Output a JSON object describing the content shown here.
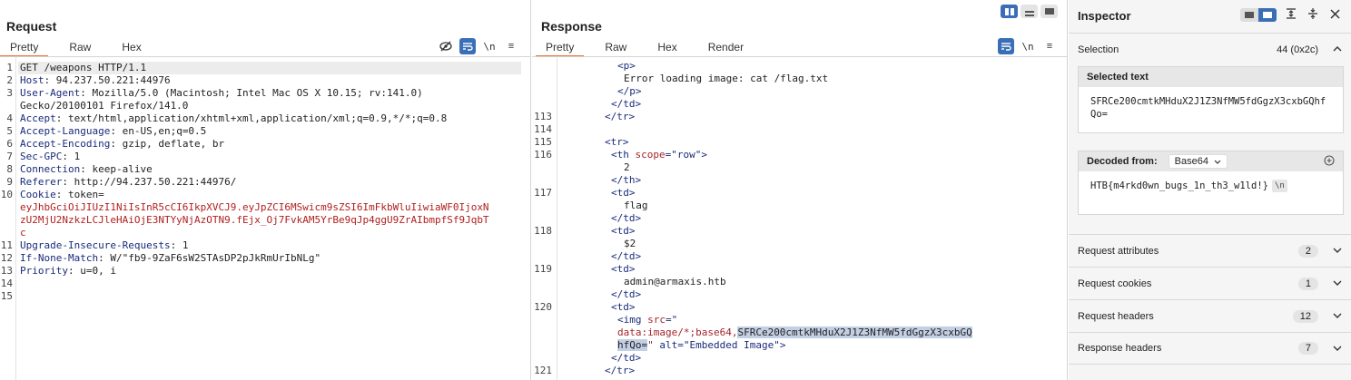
{
  "request": {
    "title": "Request",
    "tabs": [
      "Pretty",
      "Raw",
      "Hex"
    ],
    "active_tab": "Pretty",
    "tools": {
      "newline": "\\n",
      "menu": "≡"
    },
    "lines": [
      {
        "n": "1",
        "key": "",
        "val": "GET /weapons HTTP/1.1"
      },
      {
        "n": "2",
        "key": "Host",
        "val": ": 94.237.50.221:44976"
      },
      {
        "n": "3",
        "key": "User-Agent",
        "val": ": Mozilla/5.0 (Macintosh; Intel Mac OS X 10.15; rv:141.0)"
      },
      {
        "n": "",
        "key": "",
        "val": "Gecko/20100101 Firefox/141.0"
      },
      {
        "n": "4",
        "key": "Accept",
        "val": ": text/html,application/xhtml+xml,application/xml;q=0.9,*/*;q=0.8"
      },
      {
        "n": "5",
        "key": "Accept-Language",
        "val": ": en-US,en;q=0.5"
      },
      {
        "n": "6",
        "key": "Accept-Encoding",
        "val": ": gzip, deflate, br"
      },
      {
        "n": "7",
        "key": "Sec-GPC",
        "val": ": 1"
      },
      {
        "n": "8",
        "key": "Connection",
        "val": ": keep-alive"
      },
      {
        "n": "9",
        "key": "Referer",
        "val": ": http://94.237.50.221:44976/"
      },
      {
        "n": "10",
        "key": "Cookie",
        "val": ": token="
      },
      {
        "n": "",
        "key": "",
        "red": "eyJhbGciOiJIUzI1NiIsInR5cCI6IkpXVCJ9.eyJpZCI6MSwicm9sZSI6ImFkbWluIiwiaWF0IjoxN"
      },
      {
        "n": "",
        "key": "",
        "red": "zU2MjU2NzkzLCJleHAiOjE3NTYyNjAzOTN9.fEjx_Oj7FvkAM5YrBe9qJp4ggU9ZrAIbmpfSf9JqbT"
      },
      {
        "n": "",
        "key": "",
        "red": "c"
      },
      {
        "n": "11",
        "key": "Upgrade-Insecure-Requests",
        "val": ": 1"
      },
      {
        "n": "12",
        "key": "If-None-Match",
        "val": ": W/\"fb9-9ZaF6sW2STAsDP2pJkRmUrIbNLg\""
      },
      {
        "n": "13",
        "key": "Priority",
        "val": ": u=0, i"
      },
      {
        "n": "14",
        "key": "",
        "val": ""
      },
      {
        "n": "15",
        "key": "",
        "val": ""
      }
    ]
  },
  "response": {
    "title": "Response",
    "tabs": [
      "Pretty",
      "Raw",
      "Hex",
      "Render"
    ],
    "active_tab": "Pretty",
    "tools": {
      "newline": "\\n",
      "menu": "≡"
    },
    "lines": [
      {
        "n": "",
        "ind": 9,
        "parts": [
          [
            "tag",
            "<p>"
          ]
        ]
      },
      {
        "n": "",
        "ind": 10,
        "parts": [
          [
            "txt",
            "Error loading image: cat /flag.txt"
          ]
        ]
      },
      {
        "n": "",
        "ind": 9,
        "parts": [
          [
            "tag",
            "</p>"
          ]
        ]
      },
      {
        "n": "",
        "ind": 8,
        "parts": [
          [
            "tag",
            "</td>"
          ]
        ]
      },
      {
        "n": "113",
        "ind": 7,
        "parts": [
          [
            "tag",
            "</tr>"
          ]
        ]
      },
      {
        "n": "114",
        "ind": 0,
        "parts": []
      },
      {
        "n": "115",
        "ind": 7,
        "parts": [
          [
            "tag",
            "<tr>"
          ]
        ]
      },
      {
        "n": "116",
        "ind": 8,
        "parts": [
          [
            "tag",
            "<th "
          ],
          [
            "attr",
            "scope"
          ],
          [
            "tag",
            "="
          ],
          [
            "str",
            "\"row\""
          ],
          [
            "tag",
            ">"
          ]
        ]
      },
      {
        "n": "",
        "ind": 10,
        "parts": [
          [
            "txt",
            "2"
          ]
        ]
      },
      {
        "n": "",
        "ind": 8,
        "parts": [
          [
            "tag",
            "</th>"
          ]
        ]
      },
      {
        "n": "117",
        "ind": 8,
        "parts": [
          [
            "tag",
            "<td>"
          ]
        ]
      },
      {
        "n": "",
        "ind": 10,
        "parts": [
          [
            "txt",
            "flag"
          ]
        ]
      },
      {
        "n": "",
        "ind": 8,
        "parts": [
          [
            "tag",
            "</td>"
          ]
        ]
      },
      {
        "n": "118",
        "ind": 8,
        "parts": [
          [
            "tag",
            "<td>"
          ]
        ]
      },
      {
        "n": "",
        "ind": 10,
        "parts": [
          [
            "txt",
            "$2"
          ]
        ]
      },
      {
        "n": "",
        "ind": 8,
        "parts": [
          [
            "tag",
            "</td>"
          ]
        ]
      },
      {
        "n": "119",
        "ind": 8,
        "parts": [
          [
            "tag",
            "<td>"
          ]
        ]
      },
      {
        "n": "",
        "ind": 10,
        "parts": [
          [
            "txt",
            "admin@armaxis.htb"
          ]
        ]
      },
      {
        "n": "",
        "ind": 8,
        "parts": [
          [
            "tag",
            "</td>"
          ]
        ]
      },
      {
        "n": "120",
        "ind": 8,
        "parts": [
          [
            "tag",
            "<td>"
          ]
        ]
      },
      {
        "n": "",
        "ind": 9,
        "parts": [
          [
            "tag",
            "<img "
          ],
          [
            "attr",
            "src"
          ],
          [
            "tag",
            "=\""
          ]
        ]
      },
      {
        "n": "",
        "ind": 9,
        "parts": [
          [
            "attr",
            "data:image/*;base64,"
          ],
          [
            "hl",
            "SFRCe200cmtkMHduX2J1Z3NfMW5fdGgzX3cxbGQ"
          ]
        ]
      },
      {
        "n": "",
        "ind": 9,
        "parts": [
          [
            "hl",
            "hfQo="
          ],
          [
            "attr",
            "\" "
          ],
          [
            "tag",
            "alt"
          ],
          [
            "tag",
            "="
          ],
          [
            "str",
            "\"Embedded Image\""
          ],
          [
            "tag",
            ">"
          ]
        ]
      },
      {
        "n": "",
        "ind": 8,
        "parts": [
          [
            "tag",
            "</td>"
          ]
        ]
      },
      {
        "n": "121",
        "ind": 7,
        "parts": [
          [
            "tag",
            "</tr>"
          ]
        ]
      }
    ]
  },
  "inspector": {
    "title": "Inspector",
    "selection": {
      "label": "Selection",
      "count": "44 (0x2c)"
    },
    "selected_text": {
      "header": "Selected text",
      "value": "SFRCe200cmtkMHduX2J1Z3NfMW5fdGgzX3cxbGQhfQo="
    },
    "decoded": {
      "header": "Decoded from:",
      "encoding": "Base64",
      "value": "HTB{m4rkd0wn_bugs_1n_th3_w1ld!}",
      "newline": "\\n"
    },
    "sections": [
      {
        "label": "Request attributes",
        "count": "2"
      },
      {
        "label": "Request cookies",
        "count": "1"
      },
      {
        "label": "Request headers",
        "count": "12"
      },
      {
        "label": "Response headers",
        "count": "7"
      }
    ]
  }
}
